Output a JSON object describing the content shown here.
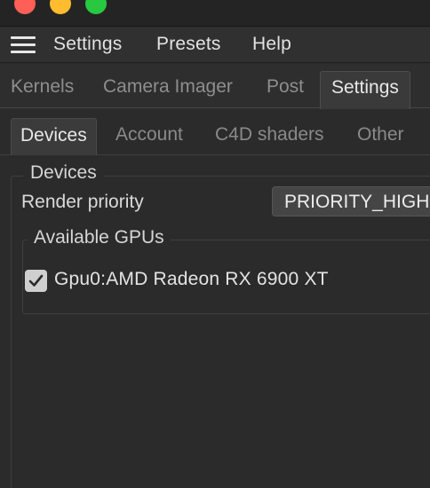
{
  "window": {
    "controls": [
      "close",
      "minimize",
      "maximize"
    ]
  },
  "menubar": {
    "icon": "hamburger-menu-icon",
    "items": [
      "Settings",
      "Presets",
      "Help"
    ]
  },
  "main_tabs": {
    "items": [
      "Kernels",
      "Camera Imager",
      "Post",
      "Settings"
    ],
    "active": "Settings"
  },
  "sub_tabs": {
    "items": [
      "Devices",
      "Account",
      "C4D shaders",
      "Other"
    ],
    "active": "Devices"
  },
  "devices": {
    "group_title": "Devices",
    "render_priority": {
      "label": "Render priority",
      "value": "PRIORITY_HIGH"
    },
    "gpus": {
      "group_title": "Available GPUs",
      "items": [
        {
          "label": "Gpu0:AMD Radeon RX 6900 XT",
          "checked": true
        }
      ]
    }
  },
  "colors": {
    "close": "#fe5f57",
    "minimize": "#febc2e",
    "maximize": "#28c840",
    "background": "#2b2b2b"
  }
}
